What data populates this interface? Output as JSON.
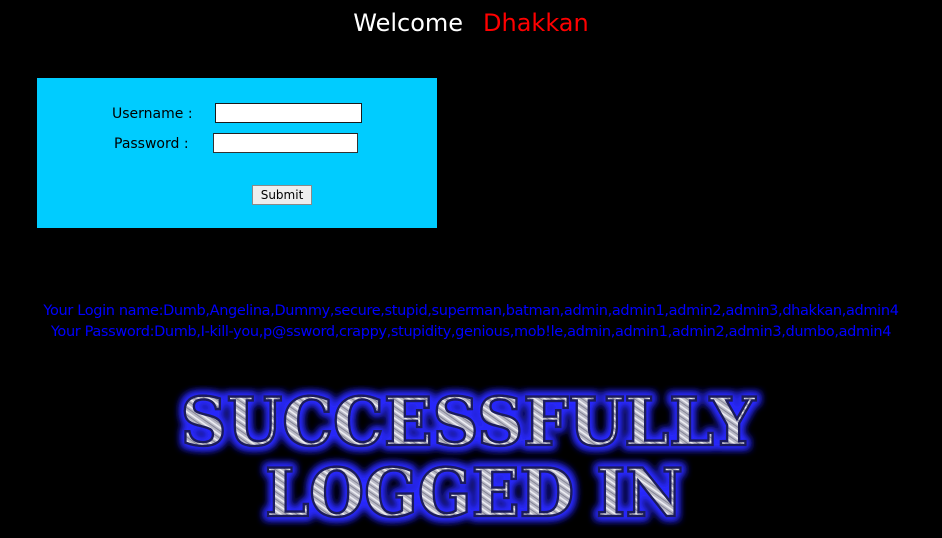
{
  "header": {
    "welcome": "Welcome",
    "name": "Dhakkan"
  },
  "form": {
    "username_label": "Username :",
    "password_label": "Password :",
    "username_value": "",
    "password_value": "",
    "submit_label": "Submit"
  },
  "results": {
    "login_line": "Your Login name:Dumb,Angelina,Dummy,secure,stupid,superman,batman,admin,admin1,admin2,admin3,dhakkan,admin4",
    "password_line": "Your Password:Dumb,I-kill-you,p@ssword,crappy,stupidity,genious,mob!le,admin,admin1,admin2,admin3,dumbo,admin4"
  },
  "banner": {
    "line1": "SUCCESSFULLY",
    "line2": "LOGGED IN"
  },
  "colors": {
    "background": "#000000",
    "panel": "#00ccff",
    "name": "#ff0000",
    "results_text": "#0000ff",
    "banner_glow": "#2a2aff"
  }
}
